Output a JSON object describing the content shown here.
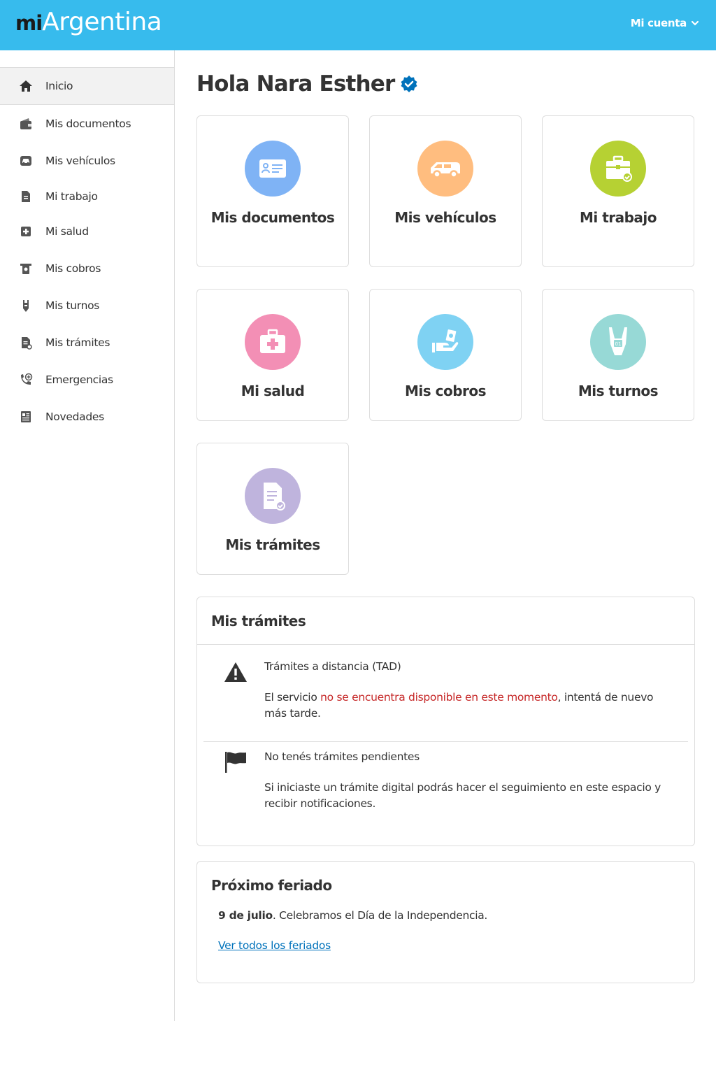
{
  "header": {
    "logo_mi": "mi",
    "logo_argentina": "Argentina",
    "account_label": "Mi cuenta",
    "account_icon": "chevron-down-icon",
    "bg_color": "#37bbed"
  },
  "sidebar": {
    "items": [
      {
        "label": "Inicio",
        "icon": "home-icon",
        "active": true
      },
      {
        "label": "Mis documentos",
        "icon": "wallet-icon"
      },
      {
        "label": "Mis vehículos",
        "icon": "car-icon"
      },
      {
        "label": "Mi trabajo",
        "icon": "document-icon"
      },
      {
        "label": "Mi salud",
        "icon": "health-cross-icon"
      },
      {
        "label": "Mis cobros",
        "icon": "money-icon"
      },
      {
        "label": "Mis turnos",
        "icon": "ticket-icon"
      },
      {
        "label": "Mis trámites",
        "icon": "paperwork-icon"
      },
      {
        "label": "Emergencias",
        "icon": "phone-plus-icon"
      },
      {
        "label": "Novedades",
        "icon": "newspaper-icon"
      }
    ]
  },
  "main": {
    "greeting": "Hola Nara Esther",
    "verified_icon": "verified-check-icon",
    "cards": [
      {
        "title": "Mis documentos",
        "icon": "id-card-icon",
        "color": "#7fb3f5"
      },
      {
        "title": "Mis vehículos",
        "icon": "van-icon",
        "color": "#ffbd7f"
      },
      {
        "title": "Mi trabajo",
        "icon": "briefcase-icon",
        "color": "#b6d133"
      },
      {
        "title": "Mi salud",
        "icon": "first-aid-kit-icon",
        "color": "#f38fb5"
      },
      {
        "title": "Mis cobros",
        "icon": "hand-money-icon",
        "color": "#7fd2f3"
      },
      {
        "title": "Mis turnos",
        "icon": "number-ticket-icon",
        "color": "#97d9d6"
      },
      {
        "title": "Mis trámites",
        "icon": "form-check-icon",
        "color": "#bfb4dd"
      }
    ]
  },
  "tramites_panel": {
    "title": "Mis trámites",
    "tad_title": "Trámites a distancia (TAD)",
    "tad_text_before": "El servicio ",
    "tad_text_red": "no se encuentra disponible en este momento",
    "tad_text_after": ", intentá de nuevo más tarde.",
    "tad_icon": "warning-icon",
    "pending_title": "No tenés trámites pendientes",
    "pending_text": "Si iniciaste un trámite digital podrás hacer el seguimiento en este espacio y recibir notificaciones.",
    "pending_icon": "flag-icon"
  },
  "holiday_panel": {
    "title": "Próximo feriado",
    "date": "9 de julio",
    "description": ". Celebramos el Día de la Independencia.",
    "link": "Ver todos los feriados"
  }
}
